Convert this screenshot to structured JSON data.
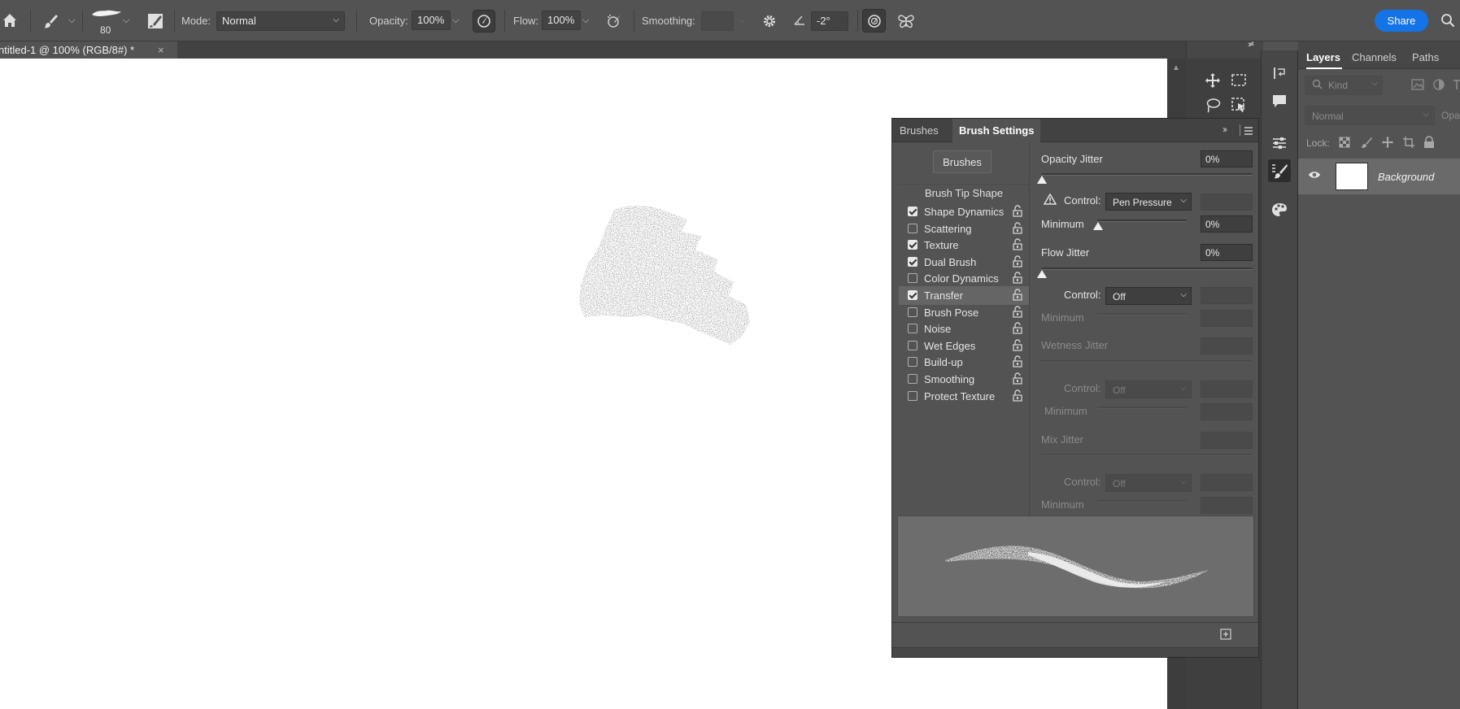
{
  "options_bar": {
    "brush_size": "80",
    "mode_label": "Mode:",
    "mode_value": "Normal",
    "opacity_label": "Opacity:",
    "opacity_value": "100%",
    "flow_label": "Flow:",
    "flow_value": "100%",
    "smoothing_label": "Smoothing:",
    "smoothing_value": "",
    "angle_value": "-2°",
    "share_label": "Share"
  },
  "document": {
    "tab_label": "ntitled-1 @ 100% (RGB/8#) *",
    "close_glyph": "×"
  },
  "layers_panel": {
    "tabs": [
      "Layers",
      "Channels",
      "Paths"
    ],
    "active_tab": "Layers",
    "kind_placeholder": "Kind",
    "blend_mode": "Normal",
    "opacity_stub": "Opa",
    "lock_label": "Lock:",
    "layers": [
      {
        "name": "Background",
        "visible": true
      }
    ]
  },
  "brush_settings": {
    "tabs": [
      "Brushes",
      "Brush Settings"
    ],
    "active_tab": "Brush Settings",
    "brushes_button": "Brushes",
    "tip_shape_label": "Brush Tip Shape",
    "options": [
      {
        "label": "Shape Dynamics",
        "checked": true,
        "selected": false
      },
      {
        "label": "Scattering",
        "checked": false,
        "selected": false
      },
      {
        "label": "Texture",
        "checked": true,
        "selected": false
      },
      {
        "label": "Dual Brush",
        "checked": true,
        "selected": false
      },
      {
        "label": "Color Dynamics",
        "checked": false,
        "selected": false
      },
      {
        "label": "Transfer",
        "checked": true,
        "selected": true
      },
      {
        "label": "Brush Pose",
        "checked": false,
        "selected": false
      },
      {
        "label": "Noise",
        "checked": false,
        "selected": false
      },
      {
        "label": "Wet Edges",
        "checked": false,
        "selected": false
      },
      {
        "label": "Build-up",
        "checked": false,
        "selected": false
      },
      {
        "label": "Smoothing",
        "checked": false,
        "selected": false
      },
      {
        "label": "Protect Texture",
        "checked": false,
        "selected": false
      }
    ],
    "transfer": {
      "opacity_jitter_label": "Opacity Jitter",
      "opacity_jitter_value": "0%",
      "control1_label": "Control:",
      "control1_value": "Pen Pressure",
      "minimum1_label": "Minimum",
      "minimum1_value": "0%",
      "flow_jitter_label": "Flow Jitter",
      "flow_jitter_value": "0%",
      "control2_label": "Control:",
      "control2_value": "Off",
      "minimum2_label": "Minimum",
      "wetness_jitter_label": "Wetness Jitter",
      "control3_label": "Control:",
      "control3_value": "Off",
      "minimum3_label": "Minimum",
      "mix_jitter_label": "Mix Jitter",
      "control4_label": "Control:",
      "control4_value": "Off",
      "minimum4_label": "Minimum"
    }
  },
  "colors": {
    "accent": "#1473e6",
    "panel": "#535353",
    "canvas": "#ffffff"
  }
}
